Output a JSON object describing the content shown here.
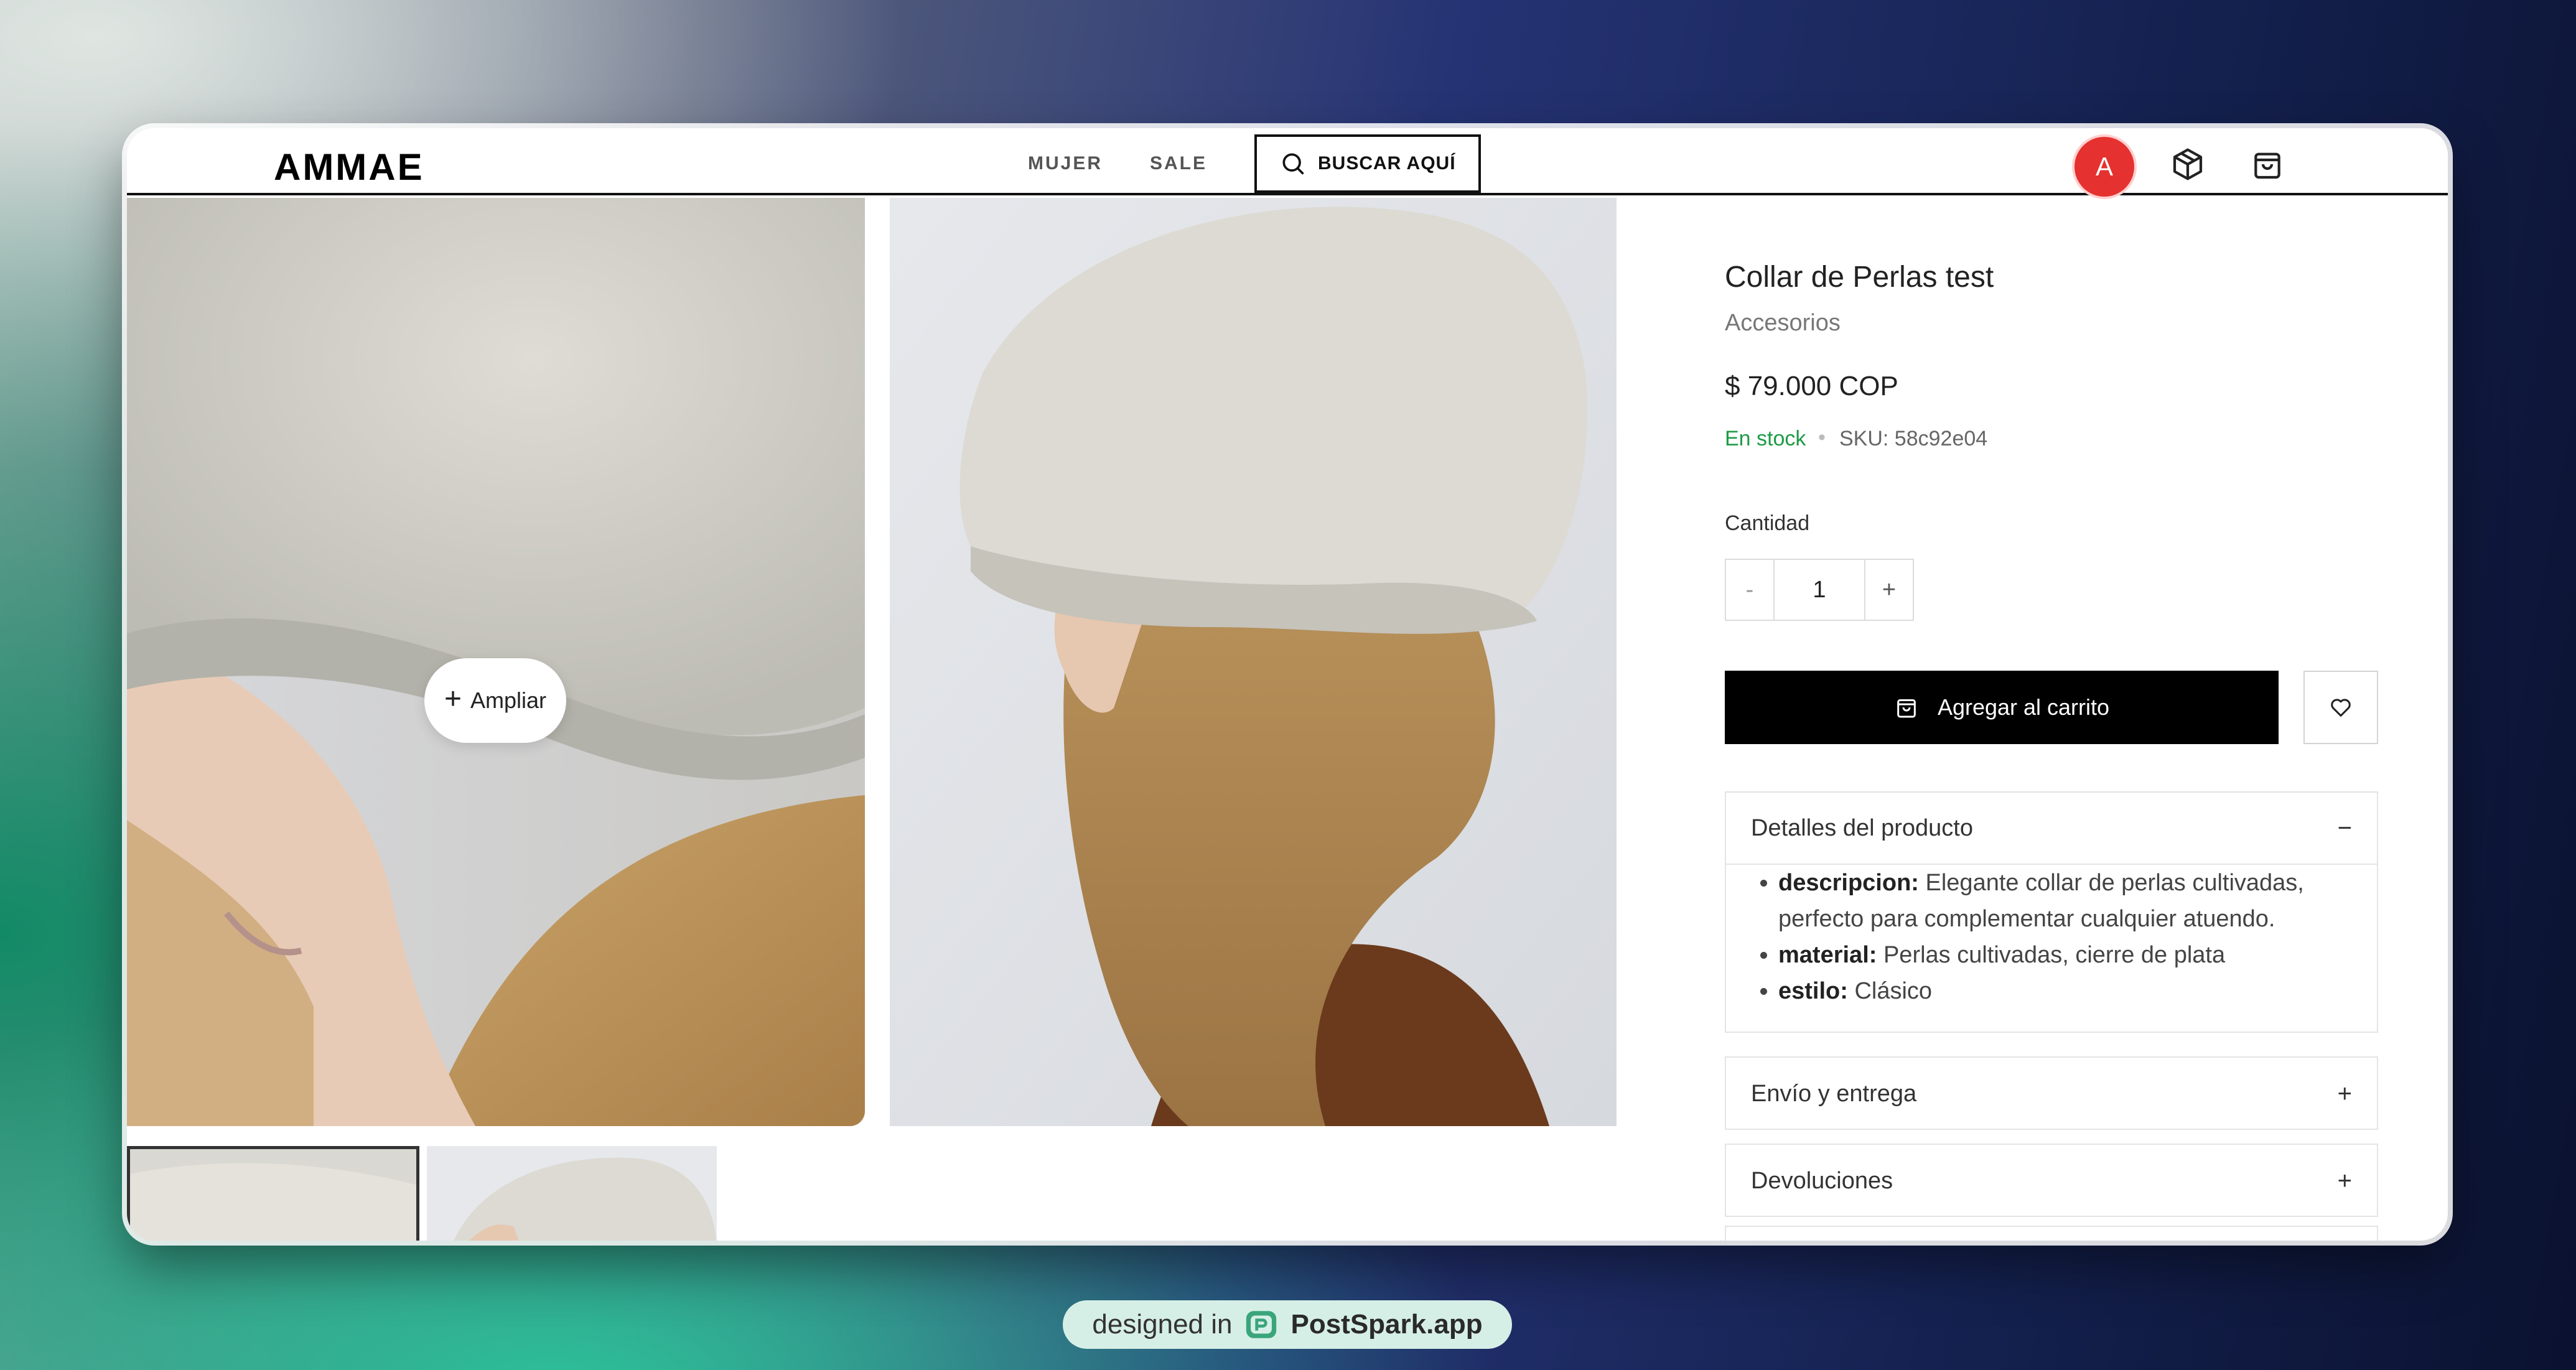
{
  "nav": {
    "logo": "AMMAE",
    "links": [
      "MUJER",
      "SALE"
    ],
    "search_label": "BUSCAR AQUÍ",
    "avatar_initial": "A"
  },
  "gallery": {
    "zoom_label": "Ampliar"
  },
  "product": {
    "title": "Collar de Perlas test",
    "category": "Accesorios",
    "price": "$ 79.000 COP",
    "stock": "En stock",
    "sku": "SKU: 58c92e04",
    "quantity_label": "Cantidad",
    "quantity_minus": "-",
    "quantity_value": "1",
    "quantity_plus": "+",
    "add_to_cart": "Agregar al carrito"
  },
  "accordion": {
    "details_title": "Detalles del producto",
    "details_sign": "−",
    "details_items": [
      {
        "key": "descripcion:",
        "value": " Elegante collar de perlas cultivadas, perfecto para complementar cualquier atuendo."
      },
      {
        "key": "material:",
        "value": " Perlas cultivadas, cierre de plata"
      },
      {
        "key": "estilo:",
        "value": " Clásico"
      }
    ],
    "shipping_title": "Envío y entrega",
    "shipping_sign": "+",
    "returns_title": "Devoluciones",
    "returns_sign": "+"
  },
  "badge": {
    "prefix": "designed in",
    "brand": "PostSpark.app"
  },
  "colors": {
    "accent_black": "#000000",
    "stock_green": "#1e9b46",
    "avatar_red": "#e5312f"
  }
}
